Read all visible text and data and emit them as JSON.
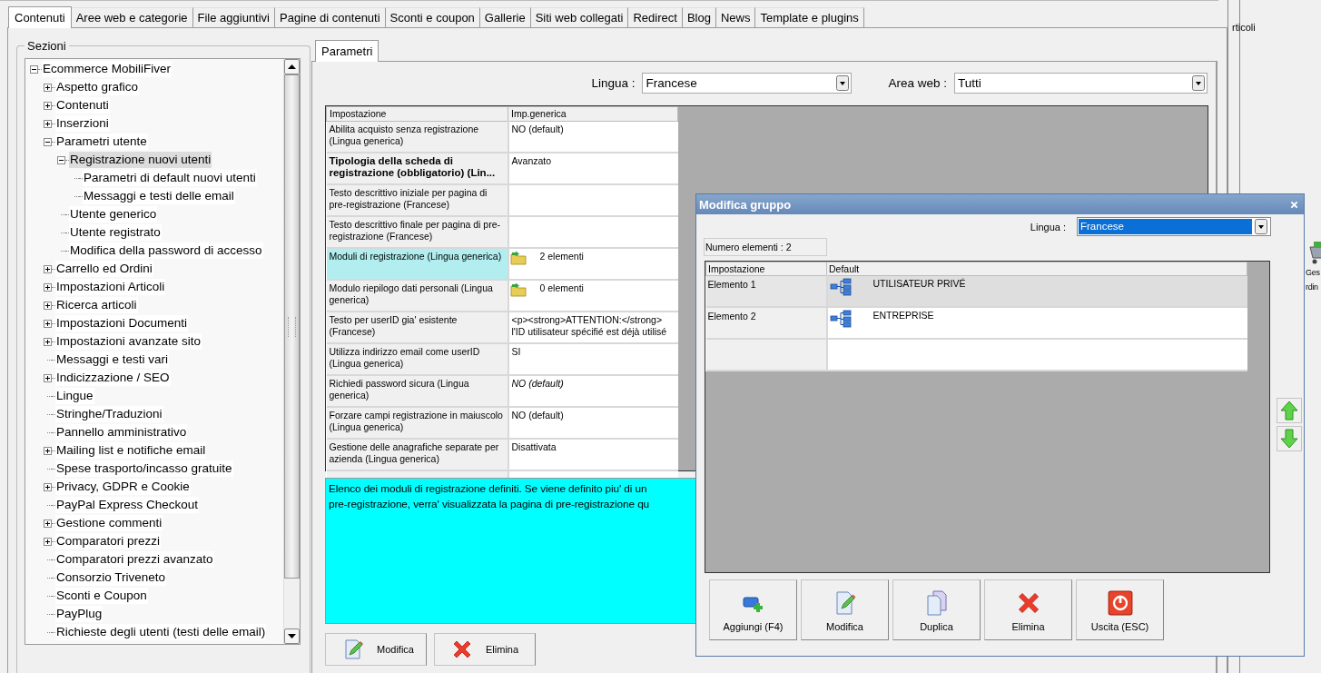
{
  "tabs": [
    {
      "label": "Contenuti",
      "selected": true
    },
    {
      "label": "Aree web e categorie",
      "selected": false
    },
    {
      "label": "File aggiuntivi",
      "selected": false
    },
    {
      "label": "Pagine di contenuti",
      "selected": false
    },
    {
      "label": "Sconti e coupon",
      "selected": false
    },
    {
      "label": "Gallerie",
      "selected": false
    },
    {
      "label": "Siti web collegati",
      "selected": false
    },
    {
      "label": "Redirect",
      "selected": false
    },
    {
      "label": "Blog",
      "selected": false
    },
    {
      "label": "News",
      "selected": false
    },
    {
      "label": "Template e plugins",
      "selected": false
    }
  ],
  "sections": {
    "title": "Sezioni",
    "tree": [
      {
        "label": "Ecommerce MobiliFiver",
        "kind": "group",
        "expanded": true,
        "selected": false,
        "children": [
          {
            "label": "Aspetto grafico",
            "kind": "group",
            "expanded": false,
            "selected": false
          },
          {
            "label": "Contenuti",
            "kind": "group",
            "expanded": false,
            "selected": false
          },
          {
            "label": "Inserzioni",
            "kind": "group",
            "expanded": false,
            "selected": false
          },
          {
            "label": "Parametri utente",
            "kind": "group",
            "expanded": true,
            "selected": false,
            "children": [
              {
                "label": "Registrazione nuovi utenti",
                "kind": "group",
                "expanded": true,
                "selected": true,
                "children": [
                  {
                    "label": "Parametri di default nuovi utenti",
                    "kind": "leaf",
                    "selected": false
                  },
                  {
                    "label": "Messaggi e testi delle email",
                    "kind": "leaf",
                    "selected": false
                  }
                ]
              },
              {
                "label": "Utente generico",
                "kind": "leaf",
                "selected": false
              },
              {
                "label": "Utente registrato",
                "kind": "leaf",
                "selected": false
              },
              {
                "label": "Modifica della password di accesso",
                "kind": "leaf",
                "selected": false
              }
            ]
          },
          {
            "label": "Carrello ed Ordini",
            "kind": "group",
            "expanded": false,
            "selected": false
          },
          {
            "label": "Impostazioni Articoli",
            "kind": "group",
            "expanded": false,
            "selected": false
          },
          {
            "label": "Ricerca articoli",
            "kind": "group",
            "expanded": false,
            "selected": false
          },
          {
            "label": "Impostazioni Documenti",
            "kind": "group",
            "expanded": false,
            "selected": false
          },
          {
            "label": "Impostazioni avanzate sito",
            "kind": "group",
            "expanded": false,
            "selected": false
          },
          {
            "label": "Messaggi e testi vari",
            "kind": "leaf",
            "selected": false
          },
          {
            "label": "Indicizzazione / SEO",
            "kind": "group",
            "expanded": false,
            "selected": false
          },
          {
            "label": "Lingue",
            "kind": "leaf",
            "selected": false
          },
          {
            "label": "Stringhe/Traduzioni",
            "kind": "leaf",
            "selected": false
          },
          {
            "label": "Pannello amministrativo",
            "kind": "leaf",
            "selected": false
          },
          {
            "label": "Mailing list e notifiche email",
            "kind": "group",
            "expanded": false,
            "selected": false
          },
          {
            "label": "Spese trasporto/incasso gratuite",
            "kind": "leaf",
            "selected": false
          },
          {
            "label": "Privacy, GDPR e Cookie",
            "kind": "group",
            "expanded": false,
            "selected": false
          },
          {
            "label": "PayPal Express Checkout",
            "kind": "leaf",
            "selected": false
          },
          {
            "label": "Gestione commenti",
            "kind": "group",
            "expanded": false,
            "selected": false
          },
          {
            "label": "Comparatori prezzi",
            "kind": "group",
            "expanded": false,
            "selected": false
          },
          {
            "label": "Comparatori prezzi avanzato",
            "kind": "leaf",
            "selected": false
          },
          {
            "label": "Consorzio Triveneto",
            "kind": "leaf",
            "selected": false
          },
          {
            "label": "Sconti e Coupon",
            "kind": "leaf",
            "selected": false
          },
          {
            "label": "PayPlug",
            "kind": "leaf",
            "selected": false
          },
          {
            "label": "Richieste degli utenti (testi delle email)",
            "kind": "leaf",
            "selected": false
          }
        ]
      }
    ]
  },
  "inner_tabs": [
    {
      "label": "Parametri",
      "selected": true
    }
  ],
  "filters": [
    {
      "label": "Lingua :",
      "value": "Francese"
    },
    {
      "label": "Area web :",
      "value": "Tutti"
    }
  ],
  "settings": {
    "columns": [
      "Impostazione",
      "Imp.generica"
    ],
    "rows": [
      {
        "setting": "Abilita acquisto senza registrazione (Lingua generica)",
        "value": "NO (default)",
        "kind": "text",
        "bold": false,
        "italic": false,
        "selected": false
      },
      {
        "setting": "Tipologia della scheda di registrazione (obbligatorio) (Lin...",
        "value": "Avanzato",
        "kind": "text",
        "bold": true,
        "italic": false,
        "selected": false
      },
      {
        "setting": "Testo descrittivo iniziale per pagina di pre-registrazione (Francese)",
        "kind": "text",
        "bold": false,
        "selected": false
      },
      {
        "setting": "Testo descrittivo finale per pagina di pre-registrazione (Francese)",
        "kind": "text",
        "bold": false,
        "selected": false
      },
      {
        "setting": "Moduli di registrazione (Lingua generica)",
        "value": "2 elementi",
        "kind": "list",
        "bold": false,
        "italic": false,
        "selected": true
      },
      {
        "setting": "Modulo riepilogo dati personali (Lingua generica)",
        "value": "0 elementi",
        "kind": "list",
        "bold": false,
        "italic": false,
        "selected": false
      },
      {
        "setting": "Testo per userID gia' esistente (Francese)",
        "value": "<p><strong>ATTENTION:</strong> l'ID utilisateur spécifié est déjà utilisé",
        "kind": "text",
        "bold": false,
        "italic": false,
        "selected": false
      },
      {
        "setting": "Utilizza indirizzo email come userID (Lingua generica)",
        "value": "SI",
        "kind": "text",
        "bold": false,
        "italic": false,
        "selected": false
      },
      {
        "setting": "Richiedi password sicura (Lingua generica)",
        "value": "NO (default)",
        "kind": "text",
        "bold": false,
        "italic": true,
        "selected": false
      },
      {
        "setting": "Forzare campi registrazione in maiuscolo (Lingua generica)",
        "value": "NO (default)",
        "kind": "text",
        "bold": false,
        "italic": false,
        "selected": false
      },
      {
        "setting": "Gestione delle anagrafiche separate per azienda (Lingua generica)",
        "value": "Disattivata",
        "kind": "text",
        "bold": false,
        "italic": false,
        "selected": false
      }
    ]
  },
  "description_lines": [
    "Elenco dei moduli di registrazione definiti. Se viene definito piu' di un",
    "pre-registrazione, verra' visualizzata la pagina di pre-registrazione qu"
  ],
  "buttons": [
    {
      "label": "Modifica",
      "kind": "edit"
    },
    {
      "label": "Elimina",
      "kind": "delete"
    }
  ],
  "right_strip": {
    "label": "rticoli",
    "shortcut_lines": [
      "Ges",
      "rdin"
    ]
  },
  "dialog": {
    "title": "Modifica gruppo",
    "language": {
      "label": "Lingua :",
      "value": "Francese"
    },
    "count": "Numero elementi : 2",
    "columns": [
      "Impostazione",
      "Default"
    ],
    "rows": [
      {
        "name": "Elemento 1",
        "value": "UTILISATEUR PRIVÉ",
        "selected": true
      },
      {
        "name": "Elemento 2",
        "value": "ENTREPRISE",
        "selected": false
      }
    ],
    "buttons": [
      {
        "label": "Aggiungi (F4)",
        "kind": "add"
      },
      {
        "label": "Modifica",
        "kind": "edit"
      },
      {
        "label": "Duplica",
        "kind": "duplicate"
      },
      {
        "label": "Elimina",
        "kind": "delete"
      },
      {
        "label": "Uscita (ESC)",
        "kind": "exit"
      }
    ]
  }
}
